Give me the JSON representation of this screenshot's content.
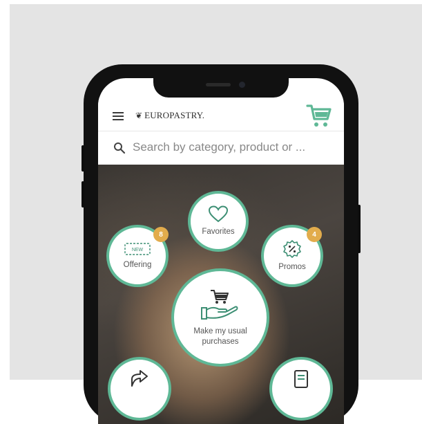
{
  "app": {
    "brand": "EUROPASTRY.",
    "accent_color": "#5fb896",
    "badge_color": "#e2ac4c"
  },
  "header": {
    "menu_icon": "hamburger-menu-icon",
    "logo_icon": "wheat-logo-icon",
    "cart_icon": "shopping-cart-icon"
  },
  "search": {
    "placeholder": "Search by category, product  or ..."
  },
  "actions": {
    "favorites": {
      "label": "Favorites",
      "icon": "heart-icon"
    },
    "offering": {
      "label": "Offering",
      "icon": "new-tag-icon",
      "tag": "NEW",
      "badge": "8"
    },
    "promos": {
      "label": "Promos",
      "icon": "percent-badge-icon",
      "badge": "4"
    },
    "usual": {
      "label_line1": "Make my usual",
      "label_line2": "purchases",
      "icon": "cart-in-hand-icon"
    },
    "share": {
      "icon": "share-arrow-icon"
    },
    "list": {
      "icon": "document-list-icon"
    }
  }
}
